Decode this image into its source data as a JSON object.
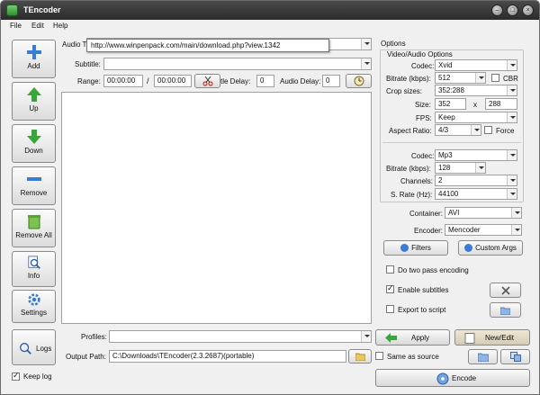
{
  "window": {
    "title": "TEncoder"
  },
  "menu": {
    "file": "File",
    "edit": "Edit",
    "help": "Help"
  },
  "toolbar": {
    "add": "Add",
    "up": "Up",
    "down": "Down",
    "remove": "Remove",
    "remove_all": "Remove All",
    "info": "Info",
    "settings": "Settings",
    "logs": "Logs",
    "keep_log": "Keep log"
  },
  "inputs": {
    "audio_track_label": "Audio T",
    "tooltip": "http://www.winpenpack.com/main/download.php?view.1342",
    "subtitle_label": "Subtitle:",
    "range_label": "Range:",
    "range_start": "00:00:00",
    "range_sep": "/",
    "range_end": "00:00:00",
    "subtitle_delay_label": "tle Delay:",
    "subtitle_delay": "0",
    "audio_delay_label": "Audio Delay:",
    "audio_delay": "0",
    "profiles_label": "Profiles:",
    "profiles_value": "",
    "output_path_label": "Output Path:",
    "output_path": "C:\\Downloads\\TEncoder(2.3.2687)(portable)"
  },
  "options": {
    "title": "Options",
    "va_group": "Video/Audio Options",
    "codec_label": "Codec:",
    "codec": "Xvid",
    "bitrate_label": "Bitrate (kbps):",
    "bitrate": "512",
    "cbr": "CBR",
    "cropsize_label": "Crop sizes:",
    "cropsize": "352:288",
    "size_label": "Size:",
    "width": "352",
    "size_x": "x",
    "height": "288",
    "fps_label": "FPS:",
    "fps": "Keep",
    "aspect_label": "Aspect Ratio:",
    "aspect": "4/3",
    "force": "Force",
    "acodec_label": "Codec:",
    "acodec": "Mp3",
    "abitrate_label": "Bitrate (kbps):",
    "abitrate": "128",
    "channels_label": "Channels:",
    "channels": "2",
    "srate_label": "S. Rate (Hz):",
    "srate": "44100",
    "container_label": "Container:",
    "container": "AVI",
    "encoder_label": "Encoder:",
    "encoder": "Mencoder",
    "filters": "Filters",
    "custom_args": "Custom Args",
    "two_pass": "Do two pass encoding",
    "enable_subs": "Enable subtitles",
    "export_script": "Export to script",
    "apply": "Apply",
    "new_edit": "New/Edit",
    "same_as_source": "Same as source",
    "encode": "Encode"
  },
  "colors": {
    "titlebar": "#2b2b2b",
    "green": "#3aa53a",
    "blue": "#3a7bd5",
    "red": "#c0392b"
  }
}
